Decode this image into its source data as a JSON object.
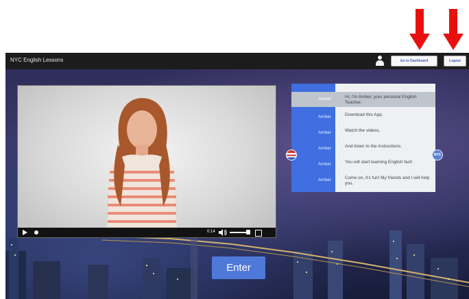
{
  "app": {
    "title": "NYC English Lessons",
    "dashboard_label": "Go to Dashboard",
    "logout_label": "Logout",
    "enter_label": "Enter"
  },
  "video": {
    "time": "0:14",
    "progress": 0.02,
    "volume": 0.85
  },
  "chat": {
    "badge_right": "NYC",
    "rows": [
      {
        "speaker": "Amber",
        "text": "Hi, I'm Amber, your personal English Teacher."
      },
      {
        "speaker": "Amber",
        "text": "Download this App."
      },
      {
        "speaker": "Amber",
        "text": "Watch the videos."
      },
      {
        "speaker": "Amber",
        "text": "And listen to the instructions."
      },
      {
        "speaker": "Amber",
        "text": "You will start learning English fast!"
      },
      {
        "speaker": "Amber",
        "text": "Come on, it's fun! My friends and I will help you."
      }
    ]
  },
  "colors": {
    "arrow": "#e8100f",
    "accent": "#4f79d9",
    "chat_speaker_column": "#3f6fe0",
    "topbar": "#1c1c1c"
  }
}
